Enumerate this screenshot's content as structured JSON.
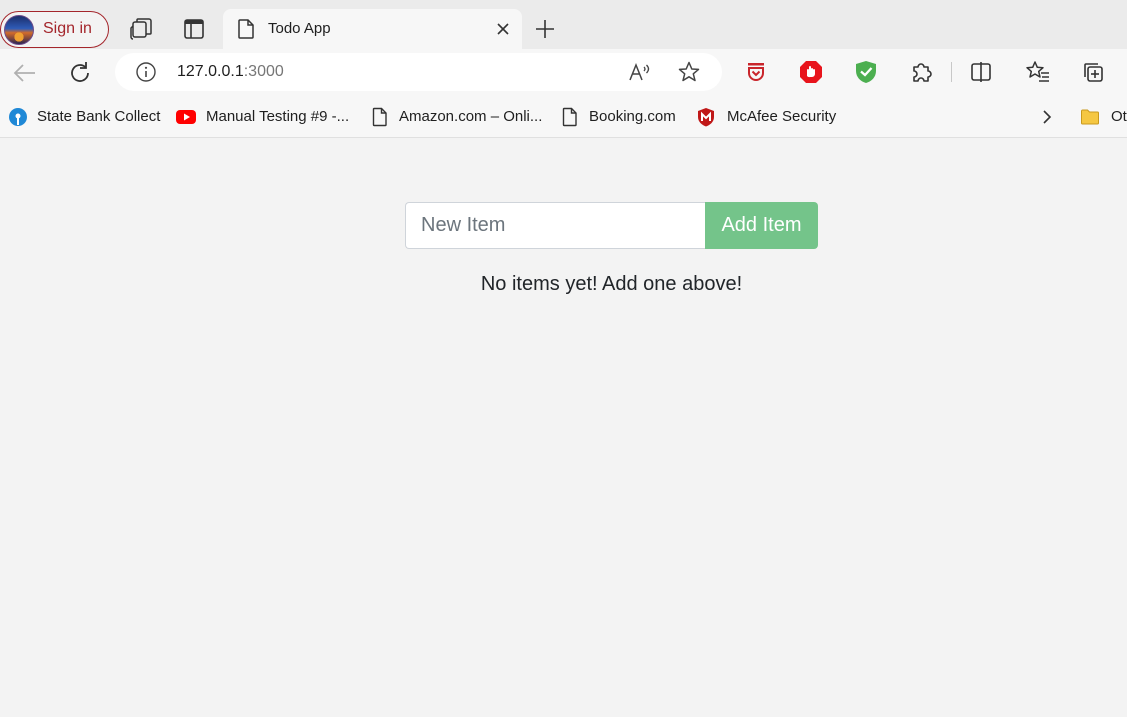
{
  "browser": {
    "profile": {
      "signin_label": "Sign in"
    },
    "tab": {
      "title": "Todo App"
    },
    "address": {
      "host": "127.0.0.1",
      "port": ":3000"
    },
    "bookmarks": [
      {
        "label": "State Bank Collect",
        "icon": "sbi-icon"
      },
      {
        "label": "Manual Testing #9 -...",
        "icon": "youtube-icon"
      },
      {
        "label": "Amazon.com – Onli...",
        "icon": "page-icon"
      },
      {
        "label": "Booking.com",
        "icon": "page-icon"
      },
      {
        "label": "McAfee Security",
        "icon": "mcafee-icon"
      },
      {
        "label": "Ot",
        "icon": "folder-icon"
      }
    ],
    "colors": {
      "profile_accent": "#a4262c",
      "adblock": "#e8141c",
      "shield": "#4caf50",
      "youtube": "#ff0000",
      "mcafee": "#c01818",
      "folder": "#f5c742"
    }
  },
  "app": {
    "input": {
      "placeholder": "New Item",
      "value": ""
    },
    "add_button_label": "Add Item",
    "empty_message": "No items yet! Add one above!",
    "colors": {
      "add_button": "#74c48a",
      "background": "#f3f3f3"
    }
  }
}
